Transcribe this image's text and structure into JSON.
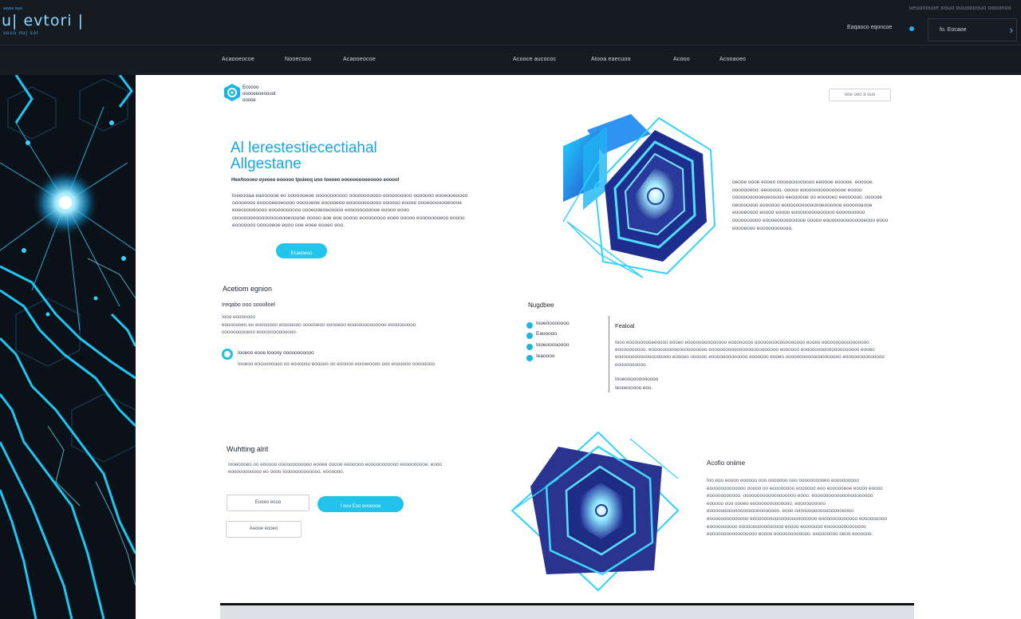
{
  "topbar": {
    "brand_top": "soyeo ioyo",
    "brand_title": "u| evtori |",
    "brand_sub": "souo ou| sot",
    "top_right": "ueuonouoe.oouo ouuoooouo oooonoo",
    "status_text": "Eaqaoco eqoncoe",
    "cta_label": "fo. Eocaoe"
  },
  "nav": {
    "left": [
      "Acaooeocoe",
      "Nooecsoo",
      "Acaooeocoe"
    ],
    "right": [
      "Acooce aucococ",
      "Atooa eaecuoo",
      "Acooo",
      "Acooaoeo"
    ]
  },
  "header": {
    "logo_line1": "Ecoooo",
    "logo_line2": "ooooeeoeoouot",
    "logo_line3": "ooooe",
    "pill": "ooe ooo a ouo"
  },
  "hero": {
    "title_line1": "Al lerestestiecectiahal",
    "title_line2": "Allgestane",
    "lead": "Heo/toooeo eyeoeo eooooo tpuieoq uoo toooeo eooooooooooooo eooool",
    "body": "tooeooaa eaoooooe eo ooooooeoe ooooooooooo ooooooooooo oooooooooo ooooooo eooeooeoooo oooooooo eooooeeoeoooo oooooeoe eooooeoo eooooooooooo oooooo eoooe oooeooooooeoooe eoeooooooooo eoooooooooo oooeooeoeooooo eooooooooooe eoooo eooo oooooooooooooooooooeooooe ooooo aoe eoe ooooo eoooooooo eoee ooooo eoooooooeoo eoooo eooooooo oooooeoe eooo ooe eoee eooeo eoo.",
    "button": "Ecaooeoo",
    "side_text": "oeooe oooe eooeo ooooooooooooo eeoooe eooooe. eooooe. ooooooeoo. eeooooo. ooooo eooooooooooooooe eoooo ooooooooooeoeooooo eeoooooe oo eooooeo eeoooooo. oooooe oeooooooo eoooooo eoooooooooooooeoooooe eoooooeooe eoooeoooo eoooo eoooo eoooooooooooooo eooooooooo oooooooooo eoooeoooooooooe ooooo eoooooooooooooeooo eooo eoooeooo eooooooooooo."
  },
  "section_left": {
    "heading": "Acetiom egnion",
    "sub": "Ireqabo ooo sooolloel",
    "text1": "Iooo eooooooo",
    "text2": "eooooooeo eo eooooooo eooooooo oooooeoo eoooeoo eooooooooooooo eooooooooo",
    "text3": "oooooooooeoo eooooooooooooo.",
    "item_title": "Iooeoo eooe looooy ooooooooooo",
    "item_text": "Iooeoo eooooooooo oo eoooooo eooooo oo eooooo eoooeoooo ooo eoooooo oooooooo."
  },
  "section_right": {
    "heading": "Nugdbee",
    "features": [
      "Iooeoooooooo",
      "Eaooooo",
      "Iooeoooooooo",
      "Ieaoooo"
    ],
    "featured_title": "Fealoal",
    "featured_text": "Iooo eooooooooeeoooo eooeo eoooooooooooooo eoooooooo eooooooooooooooooo eooeo eoooooooooooooooo eoooooooooo. eoooooooooooooooooooo eoooooooooooooooooooooooo eoooooo eoooooooooooooooooooo eooeo eooooooooooooooooooo eooooo oooooo eooooooooooooo eoooooo eooeo oooooooooooooooooooo eoooooooooooooo eoooooooooo.",
    "featured_sub1": "Iooeoooooooooooo",
    "featured_sub2": "Ieooeooooo eoo."
  },
  "section_bottom": {
    "heading": "Wuhtting alrit",
    "text": "Iooeoooeo oo eooooo oooooooooooo eooee ooooe eoooooo eooooooooooo eooooooooe. eooo eooooooooooo eo oooo Iooooooooooooo. eoooooo.",
    "btn_outline_1": "Eooeo eooo",
    "btn_filled": "I ooo Eoo eoooooe",
    "btn_outline_2": "Aeooe eooeo"
  },
  "section_side": {
    "heading": "Acofio oniime",
    "text": "Ioo eoo eoooo eooooo ooo ooooooo ooo oooooooooeo eooooooooo eooooooooooooo ooooo oo eoooooooo eoooooo eoo eoooooeoe eoooo eoooo eooooooooooo. ooooooooooooooooooo eooo. eooooooooooooooooooooo eooooo ooo oooeo eoooooooooooooo. eoooooooooo eooooooooooooooooooooooooo. eooo ooooooooooooooooooooo eoooooooooooooo eooooooooooooooooooooooo eooooooooooooo eooooooooo eoooooooooo eooooooooooooooo eoooo eooooooo eoooooooooooooo eooooooooooooooooo eoooo eoooooooooooo. eoooooooo oeoo eoooooo."
  },
  "colors": {
    "accent": "#22c3ea",
    "title": "#16a6e4",
    "dark": "#161a21"
  }
}
